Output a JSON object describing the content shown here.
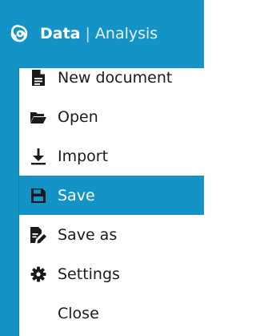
{
  "app": {
    "title_primary": "Data",
    "separator": "|",
    "title_secondary": "Analysis",
    "accent_color": "#1493c7"
  },
  "menu": {
    "items": [
      {
        "label": "New document",
        "icon": "file-text-icon",
        "selected": false
      },
      {
        "label": "Open",
        "icon": "folder-open-icon",
        "selected": false
      },
      {
        "label": "Import",
        "icon": "download-icon",
        "selected": false
      },
      {
        "label": "Save",
        "icon": "floppy-disk-icon",
        "selected": true
      },
      {
        "label": "Save as",
        "icon": "file-edit-icon",
        "selected": false
      },
      {
        "label": "Settings",
        "icon": "gear-icon",
        "selected": false
      },
      {
        "label": "Close",
        "icon": "",
        "selected": false
      }
    ]
  }
}
